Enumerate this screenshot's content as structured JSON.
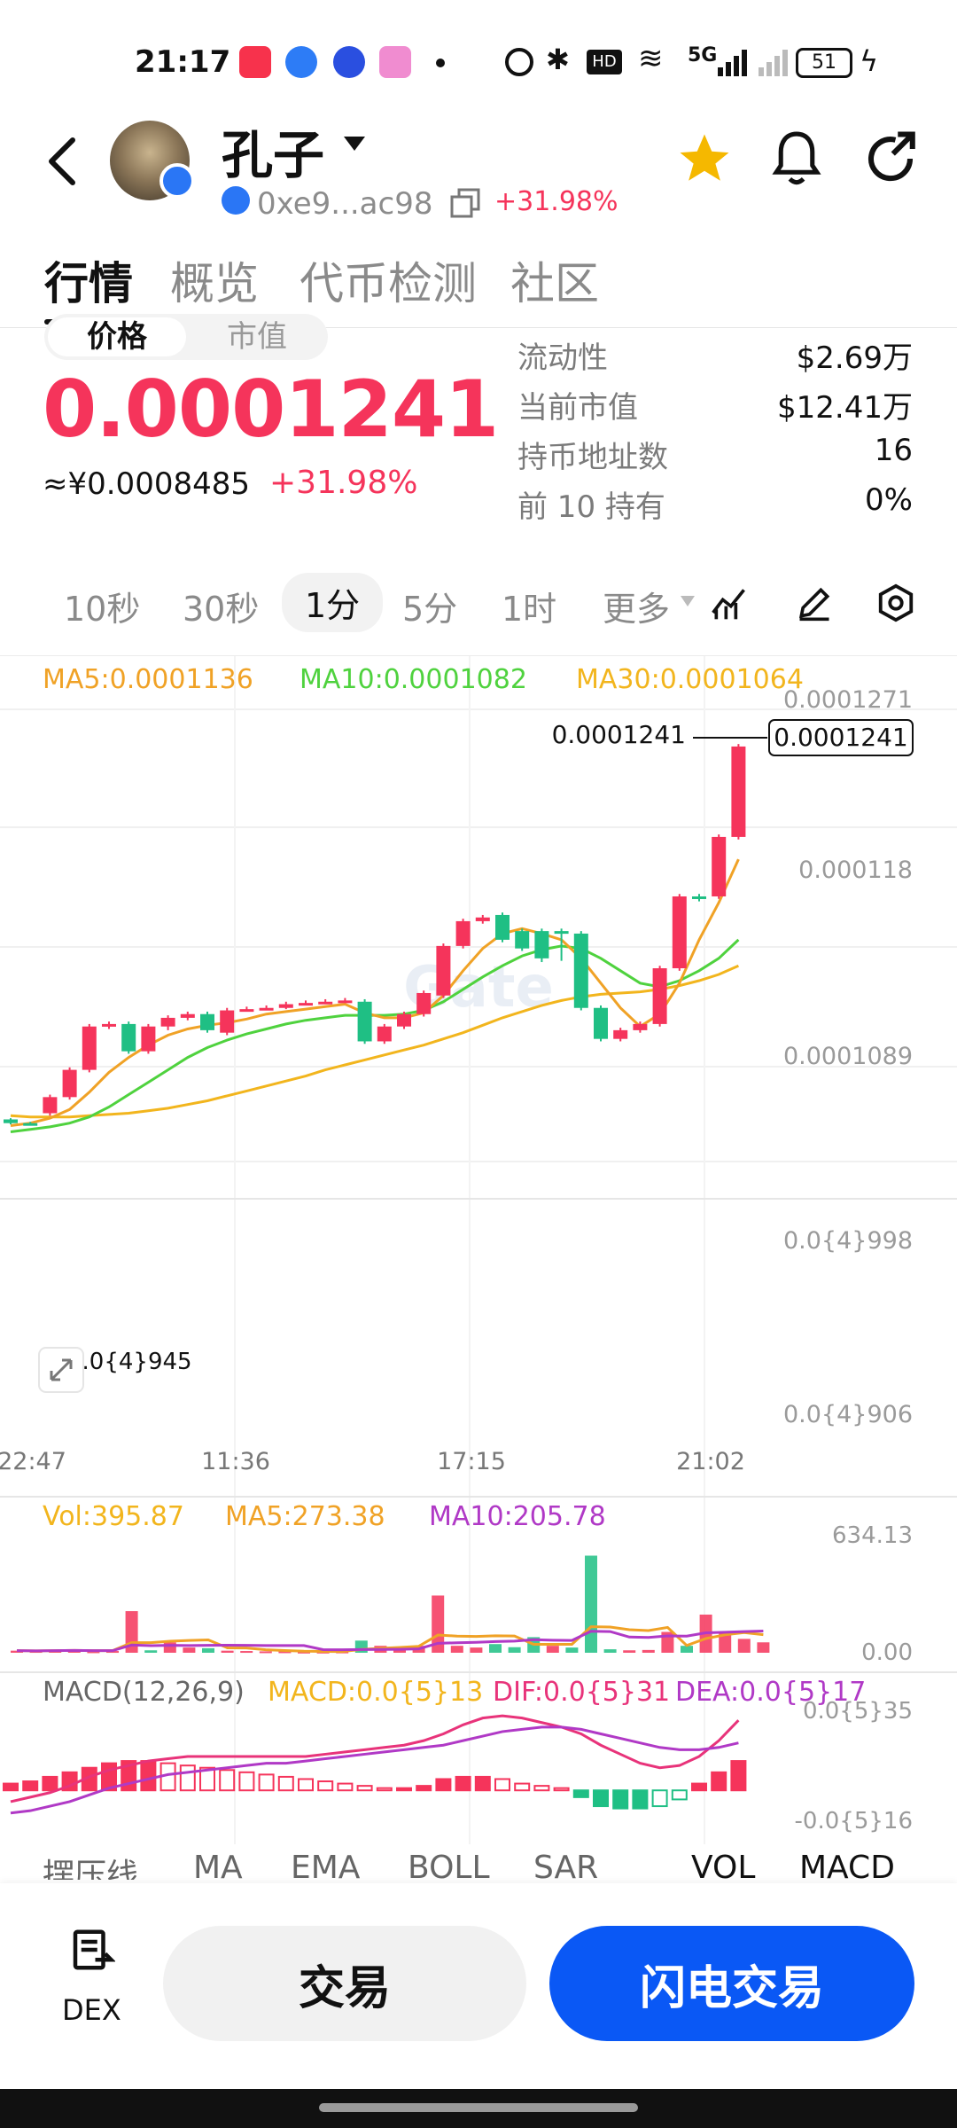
{
  "status_bar": {
    "time": "21:17",
    "network": "5G",
    "battery": "51"
  },
  "header": {
    "title": "孔子",
    "address": "0xe9...ac98",
    "change": "+31.98%"
  },
  "tabs": [
    "行情",
    "概览",
    "代币检测",
    "社区"
  ],
  "price": {
    "toggle": [
      "价格",
      "市值"
    ],
    "value": "0.0001241",
    "cny": "≈¥0.0008485",
    "change": "+31.98%"
  },
  "stats": [
    {
      "label": "流动性",
      "value": "$2.69万"
    },
    {
      "label": "当前市值",
      "value": "$12.41万"
    },
    {
      "label": "持币地址数",
      "value": "16"
    },
    {
      "label": "前 10 持有",
      "value": "0%"
    }
  ],
  "intervals": [
    "10秒",
    "30秒",
    "1分",
    "5分",
    "1时",
    "更多"
  ],
  "selected_interval": "1分",
  "colors": {
    "up": "#f5345b",
    "down": "#1fbf84",
    "accent": "#0a58f5",
    "ma5": "#f0a226",
    "ma10": "#4fd23e",
    "ma30": "#f2b51d"
  },
  "chart": {
    "watermark": "Gate",
    "ma_legend": {
      "ma5": "MA5:0.0001136",
      "ma10": "MA10:0.0001082",
      "ma30": "MA30:0.0001064"
    },
    "y_labels": [
      "0.0001271",
      "0.000118",
      "0.0001089",
      "0.0{4}998",
      "0.0{4}906"
    ],
    "last_price_label": "0.0001241",
    "last_price_tag": "0.0001241",
    "min_label": "0.0{4}945",
    "x_labels": [
      "22:47",
      "11:36",
      "17:15",
      "21:02"
    ],
    "vol_legend": {
      "vol": "Vol:395.87",
      "ma5": "MA5:273.38",
      "ma10": "MA10:205.78"
    },
    "vol_axis": [
      "634.13",
      "0.00"
    ],
    "macd_legend": {
      "macd_name": "MACD(12,26,9)",
      "macd": "MACD:0.0{5}13",
      "dif": "DIF:0.0{5}31",
      "dea": "DEA:0.0{5}17"
    },
    "macd_axis": [
      "0.0{5}35",
      "-0.0{5}16"
    ]
  },
  "chart_data": {
    "type": "candlestick",
    "y_range": [
      9.06e-05,
      0.0001271
    ],
    "candles": [
      {
        "o": 9.4e-05,
        "c": 9.37e-05,
        "h": 9.41e-05,
        "l": 9.36e-05
      },
      {
        "o": 9.37e-05,
        "c": 9.36e-05,
        "h": 9.38e-05,
        "l": 9.35e-05
      },
      {
        "o": 9.45e-05,
        "c": 9.58e-05,
        "h": 9.6e-05,
        "l": 9.43e-05
      },
      {
        "o": 9.58e-05,
        "c": 9.8e-05,
        "h": 9.82e-05,
        "l": 9.56e-05
      },
      {
        "o": 9.8e-05,
        "c": 0.0001015,
        "h": 0.0001017,
        "l": 9.78e-05
      },
      {
        "o": 0.0001015,
        "c": 0.0001017,
        "h": 0.0001019,
        "l": 0.0001013
      },
      {
        "o": 0.0001017,
        "c": 9.95e-05,
        "h": 0.0001019,
        "l": 9.93e-05
      },
      {
        "o": 9.95e-05,
        "c": 0.0001015,
        "h": 0.0001017,
        "l": 9.93e-05
      },
      {
        "o": 0.0001015,
        "c": 0.0001022,
        "h": 0.0001024,
        "l": 0.0001012
      },
      {
        "o": 0.0001022,
        "c": 0.0001025,
        "h": 0.0001027,
        "l": 0.000102
      },
      {
        "o": 0.0001025,
        "c": 0.0001012,
        "h": 0.0001027,
        "l": 0.000101
      },
      {
        "o": 0.000101,
        "c": 0.0001028,
        "h": 0.000103,
        "l": 0.0001008
      },
      {
        "o": 0.0001028,
        "c": 0.0001029,
        "h": 0.0001031,
        "l": 0.0001027
      },
      {
        "o": 0.0001029,
        "c": 0.000103,
        "h": 0.0001032,
        "l": 0.0001028
      },
      {
        "o": 0.000103,
        "c": 0.0001033,
        "h": 0.0001035,
        "l": 0.0001029
      },
      {
        "o": 0.0001033,
        "c": 0.0001034,
        "h": 0.0001036,
        "l": 0.0001032
      },
      {
        "o": 0.0001034,
        "c": 0.0001035,
        "h": 0.0001037,
        "l": 0.0001033
      },
      {
        "o": 0.0001035,
        "c": 0.0001036,
        "h": 0.0001038,
        "l": 0.0001034
      },
      {
        "o": 0.0001035,
        "c": 0.0001003,
        "h": 0.0001037,
        "l": 0.0001001
      },
      {
        "o": 0.0001003,
        "c": 0.0001015,
        "h": 0.0001017,
        "l": 0.0001001
      },
      {
        "o": 0.0001015,
        "c": 0.0001025,
        "h": 0.0001027,
        "l": 0.0001013
      },
      {
        "o": 0.0001025,
        "c": 0.0001042,
        "h": 0.0001044,
        "l": 0.0001023
      },
      {
        "o": 0.000104,
        "c": 0.000108,
        "h": 0.0001082,
        "l": 0.0001038
      },
      {
        "o": 0.000108,
        "c": 0.00011,
        "h": 0.0001102,
        "l": 0.0001078
      },
      {
        "o": 0.00011,
        "c": 0.0001103,
        "h": 0.0001105,
        "l": 0.0001098
      },
      {
        "o": 0.0001105,
        "c": 0.0001085,
        "h": 0.0001107,
        "l": 0.0001083
      },
      {
        "o": 0.0001092,
        "c": 0.0001078,
        "h": 0.0001094,
        "l": 0.0001076
      },
      {
        "o": 0.0001092,
        "c": 0.000107,
        "h": 0.0001094,
        "l": 0.0001067
      },
      {
        "o": 0.0001092,
        "c": 0.000109,
        "h": 0.0001094,
        "l": 0.0001068
      },
      {
        "o": 0.000109,
        "c": 0.000103,
        "h": 0.0001092,
        "l": 0.0001028
      },
      {
        "o": 0.000103,
        "c": 0.0001005,
        "h": 0.0001032,
        "l": 0.0001003
      },
      {
        "o": 0.0001005,
        "c": 0.0001012,
        "h": 0.0001014,
        "l": 0.0001003
      },
      {
        "o": 0.0001012,
        "c": 0.0001017,
        "h": 0.0001019,
        "l": 0.000101
      },
      {
        "o": 0.0001017,
        "c": 0.0001062,
        "h": 0.0001064,
        "l": 0.0001015
      },
      {
        "o": 0.0001062,
        "c": 0.000112,
        "h": 0.0001122,
        "l": 0.000106
      },
      {
        "o": 0.000112,
        "c": 0.0001118,
        "h": 0.0001122,
        "l": 0.0001116
      },
      {
        "o": 0.000112,
        "c": 0.0001168,
        "h": 0.000117,
        "l": 0.0001118
      },
      {
        "o": 0.0001168,
        "c": 0.0001241,
        "h": 0.0001243,
        "l": 0.0001166
      }
    ],
    "ma5": [
      9.35e-05,
      9.37e-05,
      9.41e-05,
      9.48e-05,
      9.62e-05,
      9.78e-05,
      9.9e-05,
      0.0001,
      0.0001008,
      0.0001013,
      0.0001016,
      0.0001018,
      0.0001021,
      0.0001025,
      0.0001027,
      0.0001029,
      0.0001031,
      0.0001033,
      0.0001026,
      0.0001022,
      0.0001022,
      0.0001026,
      0.000104,
      0.000106,
      0.0001078,
      0.000109,
      0.0001094,
      0.000109,
      0.0001085,
      0.000107,
      0.000105,
      0.000103,
      0.0001015,
      0.0001025,
      0.000105,
      0.0001085,
      0.0001115,
      0.000115
    ],
    "ma10": [
      9.3e-05,
      9.32e-05,
      9.34e-05,
      9.37e-05,
      9.42e-05,
      9.5e-05,
      9.6e-05,
      9.7e-05,
      9.8e-05,
      9.9e-05,
      9.98e-05,
      0.0001004,
      0.0001009,
      0.0001013,
      0.0001017,
      0.000102,
      0.0001022,
      0.0001024,
      0.0001024,
      0.0001024,
      0.0001025,
      0.0001028,
      0.0001035,
      0.0001045,
      0.0001055,
      0.0001064,
      0.0001072,
      0.0001077,
      0.000108,
      0.0001078,
      0.000107,
      0.000106,
      0.000105,
      0.0001047,
      0.0001052,
      0.000106,
      0.000107,
      0.0001085
    ],
    "ma30": [
      9.43e-05,
      9.42e-05,
      9.42e-05,
      9.42e-05,
      9.43e-05,
      9.44e-05,
      9.45e-05,
      9.47e-05,
      9.49e-05,
      9.52e-05,
      9.55e-05,
      9.59e-05,
      9.63e-05,
      9.67e-05,
      9.71e-05,
      9.75e-05,
      9.8e-05,
      9.84e-05,
      9.88e-05,
      9.92e-05,
      9.96e-05,
      0.0001,
      0.0001005,
      0.000101,
      0.0001016,
      0.0001022,
      0.0001027,
      0.0001032,
      0.0001036,
      0.0001039,
      0.0001041,
      0.0001042,
      0.0001043,
      0.0001045,
      0.0001048,
      0.0001052,
      0.0001057,
      0.0001064
    ],
    "volume": [
      12,
      10,
      14,
      18,
      8,
      10,
      240,
      14,
      60,
      30,
      26,
      12,
      10,
      8,
      8,
      6,
      6,
      7,
      70,
      40,
      30,
      40,
      330,
      40,
      30,
      50,
      32,
      90,
      40,
      30,
      560,
      20,
      14,
      16,
      120,
      40,
      220,
      120,
      80,
      60
    ],
    "volume_up": [
      true,
      true,
      true,
      true,
      true,
      true,
      true,
      false,
      true,
      true,
      false,
      true,
      true,
      true,
      true,
      true,
      true,
      true,
      false,
      true,
      true,
      true,
      true,
      true,
      true,
      false,
      false,
      false,
      true,
      false,
      false,
      false,
      true,
      true,
      true,
      false,
      true,
      true,
      true,
      true
    ],
    "volume_range": [
      0,
      634.13
    ],
    "macd_hist": [
      0.3,
      0.4,
      0.6,
      0.8,
      1.0,
      1.2,
      1.3,
      1.3,
      1.2,
      1.1,
      1.0,
      0.9,
      0.8,
      0.7,
      0.6,
      0.5,
      0.4,
      0.3,
      0.2,
      0.1,
      0.1,
      0.2,
      0.5,
      0.6,
      0.6,
      0.5,
      0.3,
      0.2,
      0.1,
      -0.3,
      -0.7,
      -0.8,
      -0.8,
      -0.7,
      -0.4,
      0.3,
      0.8,
      1.3
    ],
    "macd_dif": [
      -0.5,
      -0.3,
      -0.1,
      0.2,
      0.6,
      0.9,
      1.1,
      1.3,
      1.4,
      1.5,
      1.5,
      1.5,
      1.5,
      1.5,
      1.5,
      1.5,
      1.6,
      1.7,
      1.8,
      1.9,
      2.0,
      2.2,
      2.5,
      2.9,
      3.2,
      3.3,
      3.2,
      3.0,
      2.8,
      2.5,
      2.0,
      1.6,
      1.2,
      1.0,
      1.1,
      1.5,
      2.2,
      3.1
    ],
    "macd_dea": [
      -1.0,
      -0.9,
      -0.7,
      -0.5,
      -0.2,
      0.1,
      0.3,
      0.5,
      0.7,
      0.8,
      0.9,
      1.0,
      1.1,
      1.2,
      1.2,
      1.3,
      1.4,
      1.5,
      1.6,
      1.7,
      1.8,
      1.9,
      2.0,
      2.2,
      2.4,
      2.6,
      2.7,
      2.8,
      2.8,
      2.7,
      2.5,
      2.3,
      2.1,
      1.9,
      1.8,
      1.8,
      1.9,
      2.1
    ],
    "macd_range": [
      -1.6,
      3.5
    ]
  },
  "bottom_tabs": [
    "摆压线",
    "MA",
    "EMA",
    "BOLL",
    "SAR",
    "VOL",
    "MACD"
  ],
  "bottom_bar": {
    "dex": "DEX",
    "trade": "交易",
    "flash": "闪电交易"
  }
}
